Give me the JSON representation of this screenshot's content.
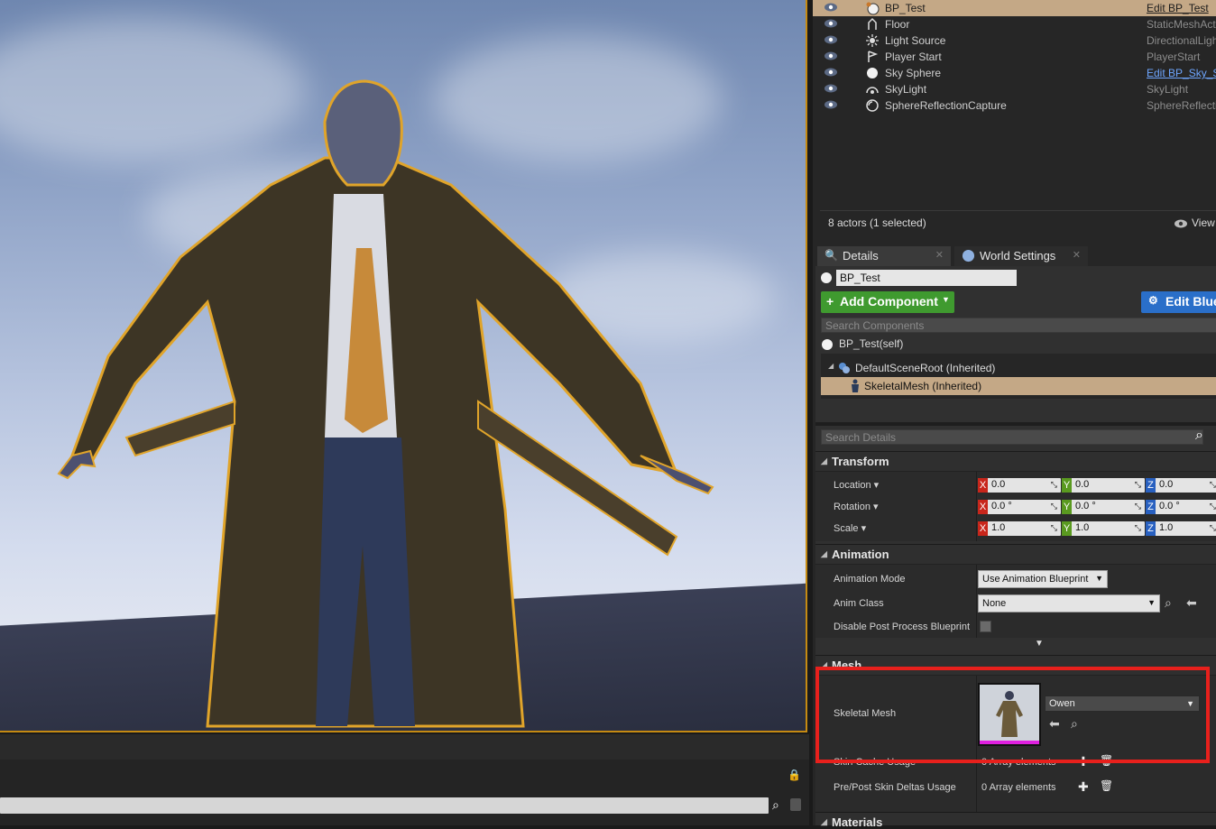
{
  "outliner": {
    "rows": [
      {
        "name": "BP_Test",
        "type": "Edit BP_Test",
        "icon": "blueprint-sphere-icon",
        "selected": true
      },
      {
        "name": "Floor",
        "type": "StaticMeshActo",
        "icon": "static-mesh-icon"
      },
      {
        "name": "Light Source",
        "type": "DirectionalLigh",
        "icon": "directional-light-icon"
      },
      {
        "name": "Player Start",
        "type": "PlayerStart",
        "icon": "player-start-icon"
      },
      {
        "name": "Sky Sphere",
        "type": "Edit BP_Sky_S",
        "icon": "sky-sphere-icon",
        "link": true
      },
      {
        "name": "SkyLight",
        "type": "SkyLight",
        "icon": "skylight-icon"
      },
      {
        "name": "SphereReflectionCapture",
        "type": "SphereReflectio",
        "icon": "reflection-capture-icon"
      }
    ],
    "actor_count": "8 actors (1 selected)",
    "view_options": "View"
  },
  "details": {
    "tabs": [
      {
        "label": "Details"
      },
      {
        "label": "World Settings"
      }
    ],
    "actor_name": "BP_Test",
    "add_component": "Add Component",
    "edit_blueprint": "Edit Blue",
    "search_components_placeholder": "Search Components",
    "self_row": "BP_Test(self)",
    "components": [
      {
        "label": "DefaultSceneRoot (Inherited)"
      },
      {
        "label": "SkeletalMesh (Inherited)"
      }
    ],
    "search_details_placeholder": "Search Details",
    "transform": {
      "title": "Transform",
      "location_label": "Location",
      "rotation_label": "Rotation",
      "scale_label": "Scale",
      "location": [
        "0.0",
        "0.0",
        "0.0"
      ],
      "rotation": [
        "0.0 °",
        "0.0 °",
        "0.0 °"
      ],
      "scale": [
        "1.0",
        "1.0",
        "1.0"
      ],
      "axes": [
        "X",
        "Y",
        "Z"
      ]
    },
    "animation": {
      "title": "Animation",
      "mode_label": "Animation Mode",
      "mode_value": "Use Animation Blueprint",
      "anim_class_label": "Anim Class",
      "anim_class_value": "None",
      "disable_pp_label": "Disable Post Process Blueprint"
    },
    "mesh": {
      "title": "Mesh",
      "skeletal_mesh_label": "Skeletal Mesh",
      "skeletal_mesh_value": "Owen",
      "skin_cache_label": "Skin Cache Usage",
      "skin_cache_value": "0 Array elements",
      "skin_deltas_label": "Pre/Post Skin Deltas Usage",
      "skin_deltas_value": "0 Array elements"
    },
    "materials": {
      "title": "Materials"
    }
  },
  "colors": {
    "selection": "#c4a886",
    "highlight_box": "#e8201c",
    "add_component": "#3f9a2f",
    "edit_blueprint": "#2a6fc9",
    "selection_outline": "#c58a12"
  }
}
